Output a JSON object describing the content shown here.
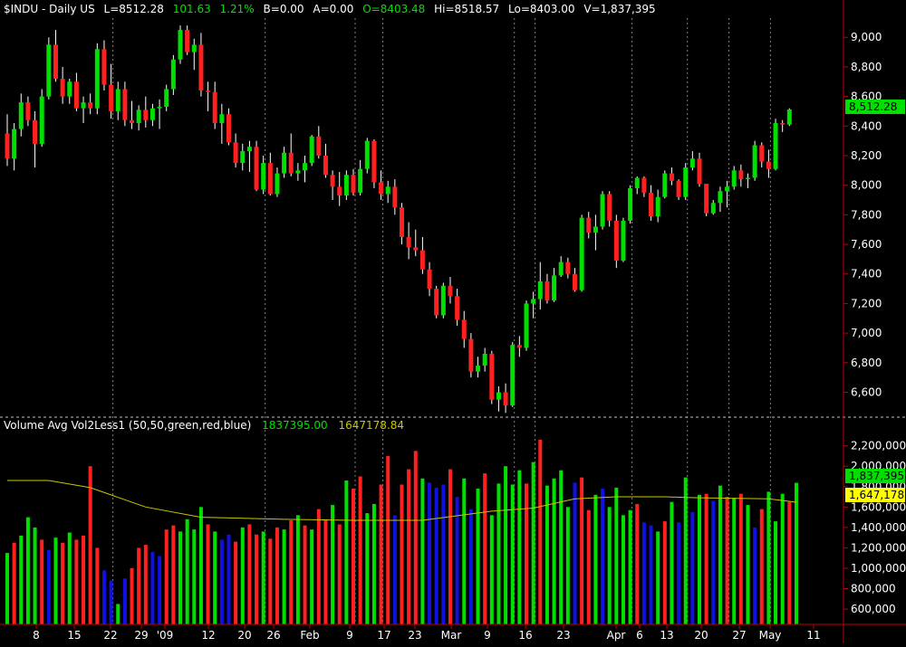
{
  "header": {
    "symbol": "$INDU - Daily  US",
    "last": "L=8512.28",
    "change": "101.63",
    "pct": "1.21%",
    "bid": "B=0.00",
    "ask": "A=0.00",
    "open": "O=8403.48",
    "high": "Hi=8518.57",
    "low": "Lo=8403.00",
    "volume": "V=1,837,395"
  },
  "volume_header": {
    "label": "Volume Avg Vol2Less1 (50,50,green,red,blue)",
    "value1": "1837395.00",
    "value2": "1647178.84"
  },
  "colors": {
    "up": "#00e000",
    "down": "#ff2020",
    "blue": "#1010e0",
    "avg": "#c8c800",
    "axis": "#c00000",
    "grid": "#808080",
    "text": "#ffffff"
  },
  "price_badge": "8,512.28",
  "vol_badge1": "1,837,395",
  "vol_badge2": "1,647,178",
  "chart_data": [
    {
      "type": "candlestick",
      "title": "$INDU - Daily  US",
      "ylim": [
        6450,
        9130
      ],
      "yticks": [
        "9,000",
        "8,800",
        "8,600",
        "8,400",
        "8,200",
        "8,000",
        "7,800",
        "7,600",
        "7,400",
        "7,200",
        "7,000",
        "6,800",
        "6,600"
      ],
      "candles": [
        [
          8350,
          8480,
          8130,
          8180
        ],
        [
          8180,
          8420,
          8100,
          8380
        ],
        [
          8380,
          8620,
          8330,
          8560
        ],
        [
          8560,
          8600,
          8400,
          8440
        ],
        [
          8440,
          8500,
          8120,
          8280
        ],
        [
          8280,
          8650,
          8260,
          8600
        ],
        [
          8600,
          9000,
          8580,
          8950
        ],
        [
          8950,
          9050,
          8700,
          8720
        ],
        [
          8720,
          8800,
          8550,
          8600
        ],
        [
          8600,
          8720,
          8550,
          8700
        ],
        [
          8700,
          8760,
          8500,
          8520
        ],
        [
          8520,
          8600,
          8420,
          8560
        ],
        [
          8560,
          8620,
          8480,
          8520
        ],
        [
          8520,
          8960,
          8480,
          8920
        ],
        [
          8920,
          8980,
          8640,
          8680
        ],
        [
          8680,
          8820,
          8450,
          8500
        ],
        [
          8500,
          8700,
          8440,
          8650
        ],
        [
          8650,
          8700,
          8400,
          8440
        ],
        [
          8440,
          8570,
          8380,
          8420
        ],
        [
          8420,
          8540,
          8370,
          8510
        ],
        [
          8510,
          8600,
          8390,
          8440
        ],
        [
          8440,
          8550,
          8400,
          8520
        ],
        [
          8520,
          8580,
          8380,
          8530
        ],
        [
          8530,
          8680,
          8500,
          8650
        ],
        [
          8650,
          8880,
          8610,
          8850
        ],
        [
          8850,
          9080,
          8820,
          9050
        ],
        [
          9050,
          9080,
          8880,
          8900
        ],
        [
          8900,
          8990,
          8780,
          8950
        ],
        [
          8950,
          9030,
          8600,
          8640
        ],
        [
          8640,
          8700,
          8500,
          8630
        ],
        [
          8630,
          8700,
          8380,
          8420
        ],
        [
          8420,
          8550,
          8280,
          8480
        ],
        [
          8480,
          8520,
          8270,
          8290
        ],
        [
          8290,
          8350,
          8120,
          8150
        ],
        [
          8150,
          8280,
          8100,
          8230
        ],
        [
          8230,
          8300,
          8090,
          8260
        ],
        [
          8260,
          8300,
          7960,
          7970
        ],
        [
          7970,
          8200,
          7940,
          8150
        ],
        [
          8150,
          8220,
          7930,
          7940
        ],
        [
          7940,
          8120,
          7920,
          8080
        ],
        [
          8080,
          8260,
          8050,
          8220
        ],
        [
          8220,
          8350,
          8060,
          8080
        ],
        [
          8080,
          8150,
          8030,
          8100
        ],
        [
          8100,
          8200,
          8020,
          8150
        ],
        [
          8150,
          8340,
          8130,
          8330
        ],
        [
          8330,
          8400,
          8180,
          8200
        ],
        [
          8200,
          8280,
          8050,
          8070
        ],
        [
          8070,
          8100,
          7900,
          7990
        ],
        [
          7990,
          8090,
          7860,
          7930
        ],
        [
          7930,
          8100,
          7900,
          8070
        ],
        [
          8070,
          8110,
          7930,
          7950
        ],
        [
          7950,
          8170,
          7930,
          8110
        ],
        [
          8110,
          8320,
          8080,
          8300
        ],
        [
          8300,
          8310,
          7980,
          8020
        ],
        [
          8020,
          8100,
          7900,
          7940
        ],
        [
          7940,
          8030,
          7880,
          7990
        ],
        [
          7990,
          8040,
          7800,
          7850
        ],
        [
          7850,
          7880,
          7600,
          7650
        ],
        [
          7650,
          7750,
          7500,
          7580
        ],
        [
          7580,
          7700,
          7520,
          7560
        ],
        [
          7560,
          7650,
          7400,
          7430
        ],
        [
          7430,
          7480,
          7250,
          7300
        ],
        [
          7300,
          7320,
          7100,
          7120
        ],
        [
          7120,
          7340,
          7100,
          7320
        ],
        [
          7320,
          7380,
          7200,
          7250
        ],
        [
          7250,
          7300,
          7050,
          7090
        ],
        [
          7090,
          7150,
          6900,
          6960
        ],
        [
          6960,
          7000,
          6700,
          6740
        ],
        [
          6740,
          6840,
          6700,
          6780
        ],
        [
          6780,
          6900,
          6740,
          6860
        ],
        [
          6860,
          6880,
          6520,
          6550
        ],
        [
          6550,
          6640,
          6470,
          6600
        ],
        [
          6600,
          6660,
          6460,
          6510
        ],
        [
          6510,
          6940,
          6500,
          6920
        ],
        [
          6920,
          6980,
          6840,
          6900
        ],
        [
          6900,
          7220,
          6880,
          7200
        ],
        [
          7200,
          7280,
          7100,
          7230
        ],
        [
          7230,
          7480,
          7160,
          7350
        ],
        [
          7350,
          7400,
          7200,
          7220
        ],
        [
          7220,
          7440,
          7210,
          7390
        ],
        [
          7390,
          7520,
          7380,
          7480
        ],
        [
          7480,
          7510,
          7370,
          7400
        ],
        [
          7400,
          7440,
          7280,
          7290
        ],
        [
          7290,
          7800,
          7280,
          7780
        ],
        [
          7780,
          7820,
          7640,
          7680
        ],
        [
          7680,
          7800,
          7560,
          7720
        ],
        [
          7720,
          7960,
          7700,
          7940
        ],
        [
          7940,
          7960,
          7720,
          7760
        ],
        [
          7760,
          7800,
          7440,
          7490
        ],
        [
          7490,
          7780,
          7480,
          7760
        ],
        [
          7760,
          8000,
          7740,
          7980
        ],
        [
          7980,
          8060,
          7940,
          8050
        ],
        [
          8050,
          8060,
          7920,
          7950
        ],
        [
          7950,
          8000,
          7760,
          7790
        ],
        [
          7790,
          7970,
          7750,
          7920
        ],
        [
          7920,
          8100,
          7910,
          8080
        ],
        [
          8080,
          8120,
          8000,
          8030
        ],
        [
          8030,
          8040,
          7900,
          7920
        ],
        [
          7920,
          8150,
          7900,
          8120
        ],
        [
          8120,
          8230,
          8100,
          8180
        ],
        [
          8180,
          8220,
          7990,
          8010
        ],
        [
          8010,
          7970,
          7790,
          7810
        ],
        [
          7810,
          7900,
          7800,
          7880
        ],
        [
          7880,
          7990,
          7820,
          7960
        ],
        [
          7960,
          8030,
          7850,
          7990
        ],
        [
          7990,
          8130,
          7970,
          8100
        ],
        [
          8100,
          8140,
          7990,
          8040
        ],
        [
          8040,
          8080,
          7980,
          8050
        ],
        [
          8050,
          8300,
          8030,
          8270
        ],
        [
          8270,
          8290,
          8120,
          8160
        ],
        [
          8160,
          8240,
          8050,
          8110
        ],
        [
          8110,
          8450,
          8100,
          8420
        ],
        [
          8420,
          8440,
          8360,
          8410
        ],
        [
          8410,
          8520,
          8400,
          8512
        ]
      ]
    },
    {
      "type": "bar",
      "title": "Volume Avg Vol2Less1 (50,50,green,red,blue)",
      "ylim": [
        450000,
        2330000
      ],
      "yticks": [
        "2,200,000",
        "2,000,000",
        "1,800,000",
        "1,600,000",
        "1,400,000",
        "1,200,000",
        "1,000,000",
        "800,000",
        "600,000"
      ],
      "categories": [
        "8",
        "15",
        "22",
        "29",
        "'09",
        "12",
        "20",
        "26",
        "Feb",
        "9",
        "17",
        "23",
        "Mar",
        "9",
        "16",
        "23",
        "Apr",
        "6",
        "13",
        "20",
        "27",
        "May",
        "11"
      ],
      "bars": [
        [
          1150000,
          "g"
        ],
        [
          1250000,
          "r"
        ],
        [
          1320000,
          "g"
        ],
        [
          1500000,
          "g"
        ],
        [
          1400000,
          "g"
        ],
        [
          1280000,
          "r"
        ],
        [
          1180000,
          "b"
        ],
        [
          1300000,
          "g"
        ],
        [
          1250000,
          "r"
        ],
        [
          1350000,
          "g"
        ],
        [
          1280000,
          "r"
        ],
        [
          1320000,
          "r"
        ],
        [
          2000000,
          "r"
        ],
        [
          1200000,
          "r"
        ],
        [
          980000,
          "b"
        ],
        [
          880000,
          "b"
        ],
        [
          650000,
          "g"
        ],
        [
          900000,
          "b"
        ],
        [
          1000000,
          "r"
        ],
        [
          1200000,
          "r"
        ],
        [
          1230000,
          "r"
        ],
        [
          1160000,
          "b"
        ],
        [
          1120000,
          "b"
        ],
        [
          1380000,
          "r"
        ],
        [
          1420000,
          "r"
        ],
        [
          1360000,
          "g"
        ],
        [
          1480000,
          "g"
        ],
        [
          1380000,
          "g"
        ],
        [
          1600000,
          "g"
        ],
        [
          1430000,
          "r"
        ],
        [
          1360000,
          "g"
        ],
        [
          1280000,
          "b"
        ],
        [
          1330000,
          "b"
        ],
        [
          1260000,
          "r"
        ],
        [
          1400000,
          "g"
        ],
        [
          1430000,
          "r"
        ],
        [
          1330000,
          "r"
        ],
        [
          1360000,
          "g"
        ],
        [
          1290000,
          "r"
        ],
        [
          1400000,
          "r"
        ],
        [
          1380000,
          "g"
        ],
        [
          1470000,
          "r"
        ],
        [
          1520000,
          "g"
        ],
        [
          1420000,
          "r"
        ],
        [
          1380000,
          "g"
        ],
        [
          1580000,
          "r"
        ],
        [
          1480000,
          "r"
        ],
        [
          1620000,
          "g"
        ],
        [
          1430000,
          "r"
        ],
        [
          1860000,
          "g"
        ],
        [
          1780000,
          "r"
        ],
        [
          1900000,
          "r"
        ],
        [
          1540000,
          "g"
        ],
        [
          1630000,
          "g"
        ],
        [
          1820000,
          "r"
        ],
        [
          2100000,
          "r"
        ],
        [
          1520000,
          "b"
        ],
        [
          1820000,
          "r"
        ],
        [
          1970000,
          "r"
        ],
        [
          2150000,
          "r"
        ],
        [
          1880000,
          "g"
        ],
        [
          1840000,
          "b"
        ],
        [
          1790000,
          "b"
        ],
        [
          1820000,
          "b"
        ],
        [
          1970000,
          "r"
        ],
        [
          1700000,
          "b"
        ],
        [
          1880000,
          "g"
        ],
        [
          1580000,
          "b"
        ],
        [
          1780000,
          "g"
        ],
        [
          1930000,
          "r"
        ],
        [
          1520000,
          "g"
        ],
        [
          1830000,
          "g"
        ],
        [
          2000000,
          "g"
        ],
        [
          1820000,
          "g"
        ],
        [
          1960000,
          "g"
        ],
        [
          1830000,
          "r"
        ],
        [
          2040000,
          "g"
        ],
        [
          2260000,
          "r"
        ],
        [
          1810000,
          "g"
        ],
        [
          1880000,
          "g"
        ],
        [
          1960000,
          "g"
        ],
        [
          1600000,
          "g"
        ],
        [
          1840000,
          "b"
        ],
        [
          1890000,
          "r"
        ],
        [
          1570000,
          "r"
        ],
        [
          1720000,
          "g"
        ],
        [
          1780000,
          "b"
        ],
        [
          1600000,
          "g"
        ],
        [
          1790000,
          "g"
        ],
        [
          1520000,
          "g"
        ],
        [
          1570000,
          "g"
        ],
        [
          1630000,
          "r"
        ],
        [
          1450000,
          "b"
        ],
        [
          1420000,
          "b"
        ],
        [
          1360000,
          "g"
        ],
        [
          1460000,
          "r"
        ],
        [
          1650000,
          "g"
        ],
        [
          1450000,
          "b"
        ],
        [
          1890000,
          "g"
        ],
        [
          1550000,
          "b"
        ],
        [
          1720000,
          "g"
        ],
        [
          1730000,
          "r"
        ],
        [
          1660000,
          "b"
        ],
        [
          1810000,
          "g"
        ],
        [
          1700000,
          "r"
        ],
        [
          1690000,
          "g"
        ],
        [
          1730000,
          "r"
        ],
        [
          1620000,
          "g"
        ],
        [
          1400000,
          "b"
        ],
        [
          1580000,
          "r"
        ],
        [
          1750000,
          "g"
        ],
        [
          1460000,
          "g"
        ],
        [
          1730000,
          "g"
        ],
        [
          1650000,
          "r"
        ],
        [
          1837395,
          "g"
        ]
      ],
      "avg": [
        [
          0,
          1860000
        ],
        [
          6,
          1860000
        ],
        [
          12,
          1790000
        ],
        [
          20,
          1600000
        ],
        [
          28,
          1500000
        ],
        [
          40,
          1480000
        ],
        [
          50,
          1470000
        ],
        [
          60,
          1470000
        ],
        [
          70,
          1560000
        ],
        [
          76,
          1590000
        ],
        [
          82,
          1680000
        ],
        [
          88,
          1700000
        ],
        [
          95,
          1700000
        ],
        [
          100,
          1690000
        ],
        [
          110,
          1680000
        ],
        [
          114,
          1647178
        ]
      ]
    }
  ]
}
